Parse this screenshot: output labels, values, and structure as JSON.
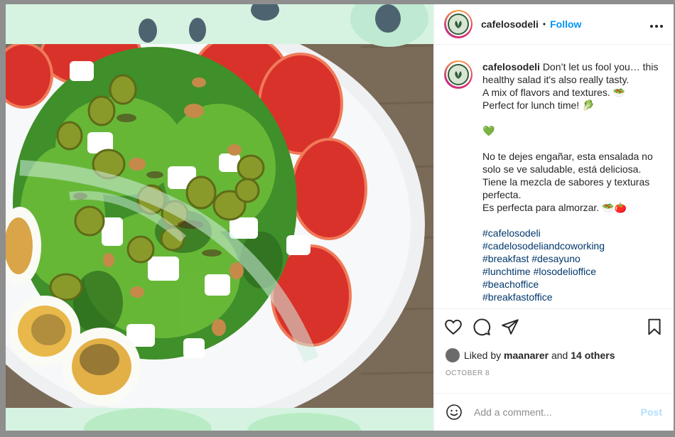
{
  "header": {
    "username": "cafelosodeli",
    "separator": "•",
    "follow_label": "Follow",
    "more_label": "•••"
  },
  "caption": {
    "username": "cafelosodeli",
    "lines": [
      "Don’t let us fool you… this healthy salad it's also really tasty.",
      "A mix of flavors and textures. 🥗",
      "Perfect for lunch time! 🥬",
      "💚",
      "No te dejes engañar, esta ensalada no solo se ve saludable, está deliciosa.",
      "Tiene la mezcla de sabores y texturas perfecta.",
      "Es perfecta para almorzar. 🥗🍅"
    ],
    "hashtags": [
      "#cafelosodeli",
      "#cadelosodeliandcoworking",
      "#breakfast #desayuno",
      "#lunchtime #losodelioffice",
      "#beachoffice",
      "#breakfastoffice"
    ]
  },
  "actions": {
    "like_icon": "heart-icon",
    "comment_icon": "comment-icon",
    "share_icon": "share-icon",
    "save_icon": "bookmark-icon"
  },
  "likes": {
    "prefix": "Liked by",
    "user": "maanarer",
    "and": "and",
    "others": "14 others"
  },
  "date": "OCTOBER 8",
  "comment_box": {
    "placeholder": "Add a comment...",
    "post_label": "Post",
    "emoji_icon": "smiley-icon"
  },
  "colors": {
    "link_blue": "#0095f6",
    "hashtag_blue": "#00376b",
    "post_disabled": "#b2dffc"
  }
}
